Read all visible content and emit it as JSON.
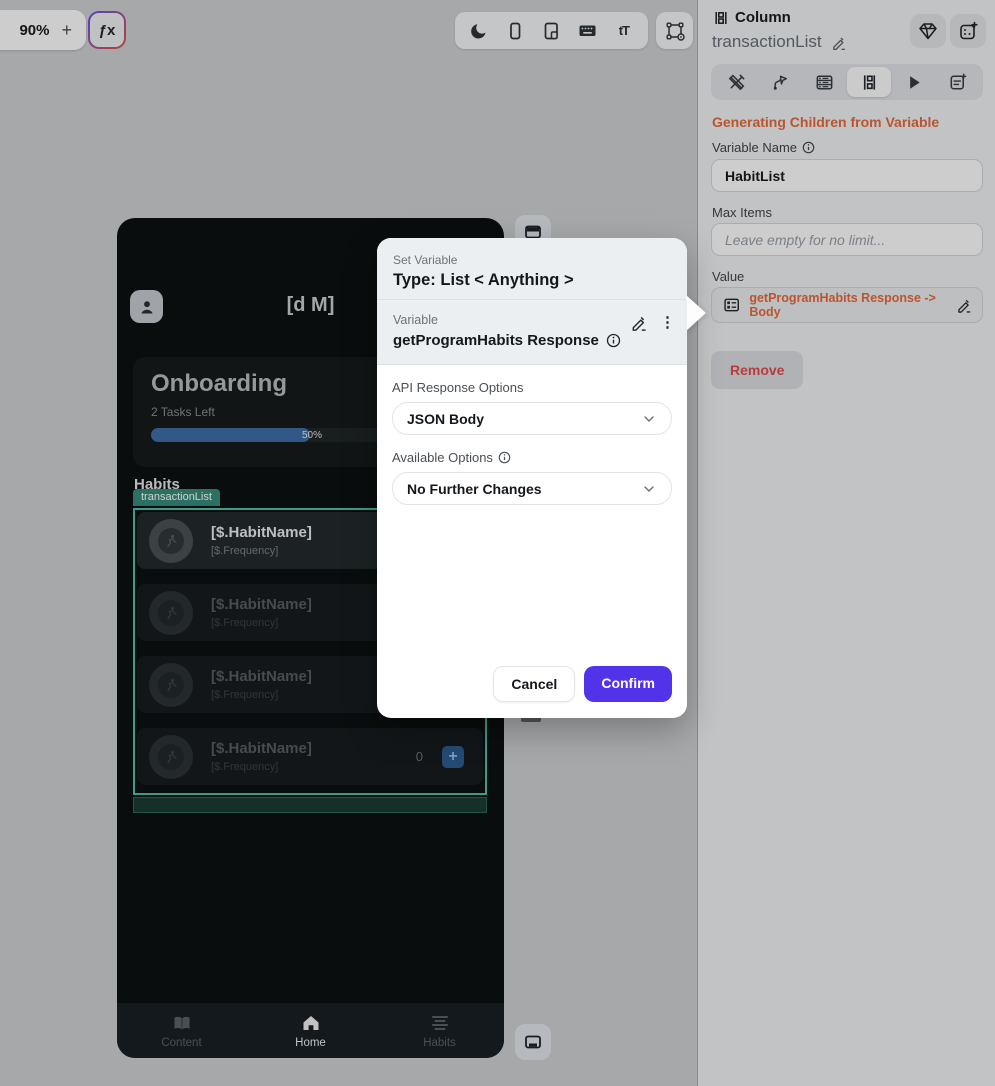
{
  "toolbar": {
    "zoom_level": "90%",
    "zoom_in_label": "+",
    "fx_glyph": "ƒx",
    "text_size_glyph": "tT"
  },
  "phone": {
    "title": "[d M]",
    "card": {
      "title": "Onboarding",
      "subtitle": "2 Tasks Left",
      "progress_label": "50%",
      "progress_pct": 50
    },
    "section_title": "Habits",
    "selection_tag": "transactionList",
    "items": [
      {
        "name": "[$.HabitName]",
        "frequency": "[$.Frequency]"
      },
      {
        "name": "[$.HabitName]",
        "frequency": "[$.Frequency]"
      },
      {
        "name": "[$.HabitName]",
        "frequency": "[$.Frequency]"
      },
      {
        "name": "[$.HabitName]",
        "frequency": "[$.Frequency]"
      }
    ],
    "count_badge": "0",
    "plus_glyph": "+",
    "nav": [
      {
        "label": "Content"
      },
      {
        "label": "Home"
      },
      {
        "label": "Habits"
      }
    ]
  },
  "panel": {
    "type_label": "Column",
    "name": "transactionList",
    "section_heading": "Generating Children from Variable",
    "variable_name_label": "Variable Name",
    "variable_name_value": "HabitList",
    "max_items_label": "Max Items",
    "max_items_placeholder": "Leave empty for no limit...",
    "value_label": "Value",
    "value_text": "getProgramHabits Response -> Body",
    "remove_label": "Remove"
  },
  "modal": {
    "eyebrow": "Set Variable",
    "title": "Type: List < Anything >",
    "variable_label": "Variable",
    "variable_value": "getProgramHabits Response",
    "dots_glyph": "⋮",
    "fields": [
      {
        "label": "API Response Options",
        "value": "JSON Body"
      },
      {
        "label": "Available Options",
        "value": "No Further Changes"
      }
    ],
    "cancel_label": "Cancel",
    "confirm_label": "Confirm"
  },
  "colors": {
    "accent_orange": "#e8693a",
    "selection_teal": "#4bc0a5",
    "tag_teal": "#378b7a",
    "confirm_purple": "#5233ea",
    "progress_blue": "#3d6da6",
    "add_button_blue": "#2c5d92",
    "remove_red": "#e24c4c"
  }
}
